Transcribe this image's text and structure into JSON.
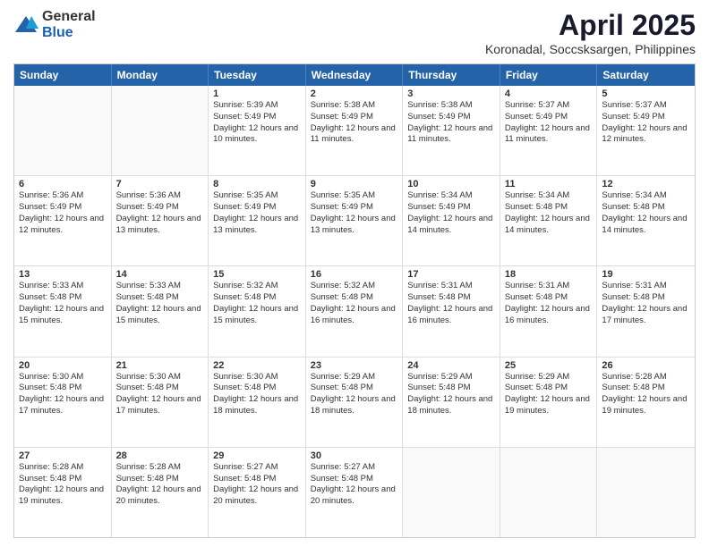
{
  "logo": {
    "general": "General",
    "blue": "Blue"
  },
  "header": {
    "title": "April 2025",
    "subtitle": "Koronadal, Soccsksargen, Philippines"
  },
  "weekdays": [
    "Sunday",
    "Monday",
    "Tuesday",
    "Wednesday",
    "Thursday",
    "Friday",
    "Saturday"
  ],
  "weeks": [
    [
      {
        "day": "",
        "sunrise": "",
        "sunset": "",
        "daylight": ""
      },
      {
        "day": "",
        "sunrise": "",
        "sunset": "",
        "daylight": ""
      },
      {
        "day": "1",
        "sunrise": "Sunrise: 5:39 AM",
        "sunset": "Sunset: 5:49 PM",
        "daylight": "Daylight: 12 hours and 10 minutes."
      },
      {
        "day": "2",
        "sunrise": "Sunrise: 5:38 AM",
        "sunset": "Sunset: 5:49 PM",
        "daylight": "Daylight: 12 hours and 11 minutes."
      },
      {
        "day": "3",
        "sunrise": "Sunrise: 5:38 AM",
        "sunset": "Sunset: 5:49 PM",
        "daylight": "Daylight: 12 hours and 11 minutes."
      },
      {
        "day": "4",
        "sunrise": "Sunrise: 5:37 AM",
        "sunset": "Sunset: 5:49 PM",
        "daylight": "Daylight: 12 hours and 11 minutes."
      },
      {
        "day": "5",
        "sunrise": "Sunrise: 5:37 AM",
        "sunset": "Sunset: 5:49 PM",
        "daylight": "Daylight: 12 hours and 12 minutes."
      }
    ],
    [
      {
        "day": "6",
        "sunrise": "Sunrise: 5:36 AM",
        "sunset": "Sunset: 5:49 PM",
        "daylight": "Daylight: 12 hours and 12 minutes."
      },
      {
        "day": "7",
        "sunrise": "Sunrise: 5:36 AM",
        "sunset": "Sunset: 5:49 PM",
        "daylight": "Daylight: 12 hours and 13 minutes."
      },
      {
        "day": "8",
        "sunrise": "Sunrise: 5:35 AM",
        "sunset": "Sunset: 5:49 PM",
        "daylight": "Daylight: 12 hours and 13 minutes."
      },
      {
        "day": "9",
        "sunrise": "Sunrise: 5:35 AM",
        "sunset": "Sunset: 5:49 PM",
        "daylight": "Daylight: 12 hours and 13 minutes."
      },
      {
        "day": "10",
        "sunrise": "Sunrise: 5:34 AM",
        "sunset": "Sunset: 5:49 PM",
        "daylight": "Daylight: 12 hours and 14 minutes."
      },
      {
        "day": "11",
        "sunrise": "Sunrise: 5:34 AM",
        "sunset": "Sunset: 5:48 PM",
        "daylight": "Daylight: 12 hours and 14 minutes."
      },
      {
        "day": "12",
        "sunrise": "Sunrise: 5:34 AM",
        "sunset": "Sunset: 5:48 PM",
        "daylight": "Daylight: 12 hours and 14 minutes."
      }
    ],
    [
      {
        "day": "13",
        "sunrise": "Sunrise: 5:33 AM",
        "sunset": "Sunset: 5:48 PM",
        "daylight": "Daylight: 12 hours and 15 minutes."
      },
      {
        "day": "14",
        "sunrise": "Sunrise: 5:33 AM",
        "sunset": "Sunset: 5:48 PM",
        "daylight": "Daylight: 12 hours and 15 minutes."
      },
      {
        "day": "15",
        "sunrise": "Sunrise: 5:32 AM",
        "sunset": "Sunset: 5:48 PM",
        "daylight": "Daylight: 12 hours and 15 minutes."
      },
      {
        "day": "16",
        "sunrise": "Sunrise: 5:32 AM",
        "sunset": "Sunset: 5:48 PM",
        "daylight": "Daylight: 12 hours and 16 minutes."
      },
      {
        "day": "17",
        "sunrise": "Sunrise: 5:31 AM",
        "sunset": "Sunset: 5:48 PM",
        "daylight": "Daylight: 12 hours and 16 minutes."
      },
      {
        "day": "18",
        "sunrise": "Sunrise: 5:31 AM",
        "sunset": "Sunset: 5:48 PM",
        "daylight": "Daylight: 12 hours and 16 minutes."
      },
      {
        "day": "19",
        "sunrise": "Sunrise: 5:31 AM",
        "sunset": "Sunset: 5:48 PM",
        "daylight": "Daylight: 12 hours and 17 minutes."
      }
    ],
    [
      {
        "day": "20",
        "sunrise": "Sunrise: 5:30 AM",
        "sunset": "Sunset: 5:48 PM",
        "daylight": "Daylight: 12 hours and 17 minutes."
      },
      {
        "day": "21",
        "sunrise": "Sunrise: 5:30 AM",
        "sunset": "Sunset: 5:48 PM",
        "daylight": "Daylight: 12 hours and 17 minutes."
      },
      {
        "day": "22",
        "sunrise": "Sunrise: 5:30 AM",
        "sunset": "Sunset: 5:48 PM",
        "daylight": "Daylight: 12 hours and 18 minutes."
      },
      {
        "day": "23",
        "sunrise": "Sunrise: 5:29 AM",
        "sunset": "Sunset: 5:48 PM",
        "daylight": "Daylight: 12 hours and 18 minutes."
      },
      {
        "day": "24",
        "sunrise": "Sunrise: 5:29 AM",
        "sunset": "Sunset: 5:48 PM",
        "daylight": "Daylight: 12 hours and 18 minutes."
      },
      {
        "day": "25",
        "sunrise": "Sunrise: 5:29 AM",
        "sunset": "Sunset: 5:48 PM",
        "daylight": "Daylight: 12 hours and 19 minutes."
      },
      {
        "day": "26",
        "sunrise": "Sunrise: 5:28 AM",
        "sunset": "Sunset: 5:48 PM",
        "daylight": "Daylight: 12 hours and 19 minutes."
      }
    ],
    [
      {
        "day": "27",
        "sunrise": "Sunrise: 5:28 AM",
        "sunset": "Sunset: 5:48 PM",
        "daylight": "Daylight: 12 hours and 19 minutes."
      },
      {
        "day": "28",
        "sunrise": "Sunrise: 5:28 AM",
        "sunset": "Sunset: 5:48 PM",
        "daylight": "Daylight: 12 hours and 20 minutes."
      },
      {
        "day": "29",
        "sunrise": "Sunrise: 5:27 AM",
        "sunset": "Sunset: 5:48 PM",
        "daylight": "Daylight: 12 hours and 20 minutes."
      },
      {
        "day": "30",
        "sunrise": "Sunrise: 5:27 AM",
        "sunset": "Sunset: 5:48 PM",
        "daylight": "Daylight: 12 hours and 20 minutes."
      },
      {
        "day": "",
        "sunrise": "",
        "sunset": "",
        "daylight": ""
      },
      {
        "day": "",
        "sunrise": "",
        "sunset": "",
        "daylight": ""
      },
      {
        "day": "",
        "sunrise": "",
        "sunset": "",
        "daylight": ""
      }
    ]
  ]
}
